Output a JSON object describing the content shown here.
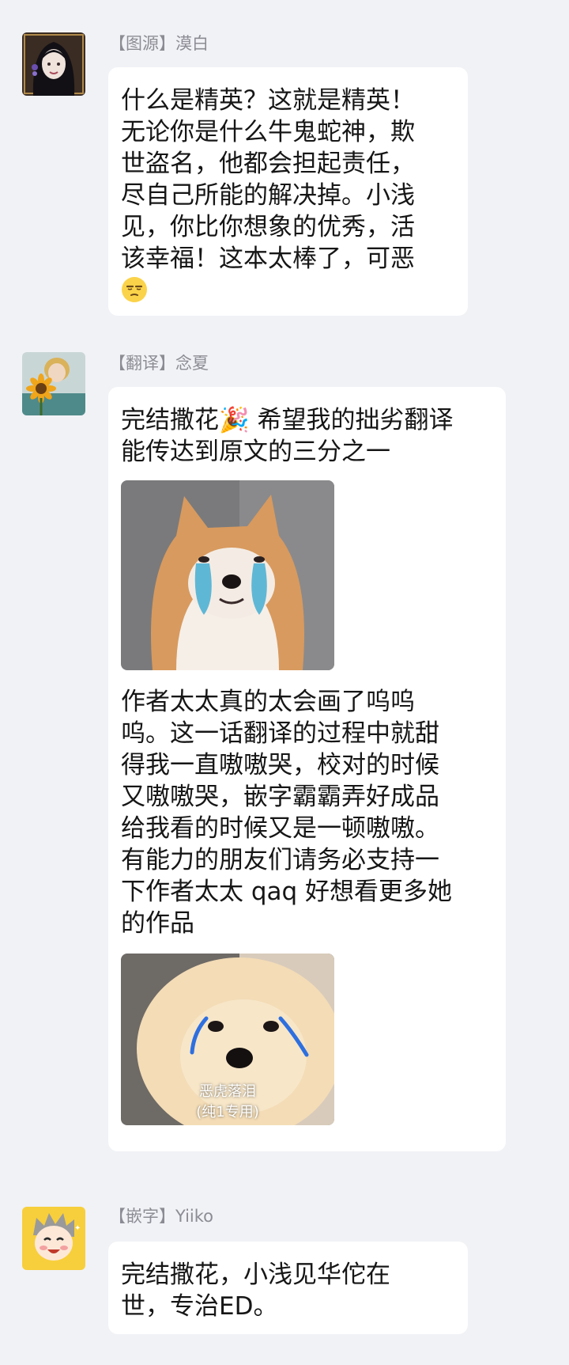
{
  "comments": [
    {
      "author": "【图源】漠白",
      "avatar_icon": "dark-haired-girl-avatar-icon",
      "lines": [
        "什么是精英？这就是精英！",
        "无论你是什么牛鬼蛇神，欺",
        "世盗名，他都会担起责任，",
        "尽自己所能的解决掉。小浅",
        "见，你比你想象的优秀，活",
        "该幸福！这本太棒了，可恶"
      ],
      "emoji": "unamused-face-emoji"
    },
    {
      "author": "【翻译】念夏",
      "avatar_icon": "sunflower-avatar-icon",
      "lines_a": [
        "完结撒花🎉 希望我的拙劣翻译",
        "能传达到原文的三分之一"
      ],
      "sticker_a": "crying-shiba-sticker",
      "lines_b": [
        "作者太太真的太会画了呜呜",
        "呜。这一话翻译的过程中就甜",
        "得我一直嗷嗷哭，校对的时候",
        "又嗷嗷哭，嵌字霸霸弄好成品",
        "给我看的时候又是一顿嗷嗷。",
        "有能力的朋友们请务必支持一",
        "下作者太太 qaq 好想看更多她",
        "的作品"
      ],
      "sticker_b": "crying-pomeranian-sticker",
      "sticker_b_caption": [
        "恶虎落泪",
        "(纯1专用)"
      ]
    },
    {
      "author": "【嵌字】Yiiko",
      "avatar_icon": "cartoon-boy-avatar-icon",
      "lines": [
        "完结撒花，小浅见华佗在",
        "世，专治ED。"
      ]
    }
  ],
  "colors": {
    "background": "#f1f2f6",
    "bubble": "#ffffff",
    "name": "#8c8c94",
    "text": "#161616"
  }
}
